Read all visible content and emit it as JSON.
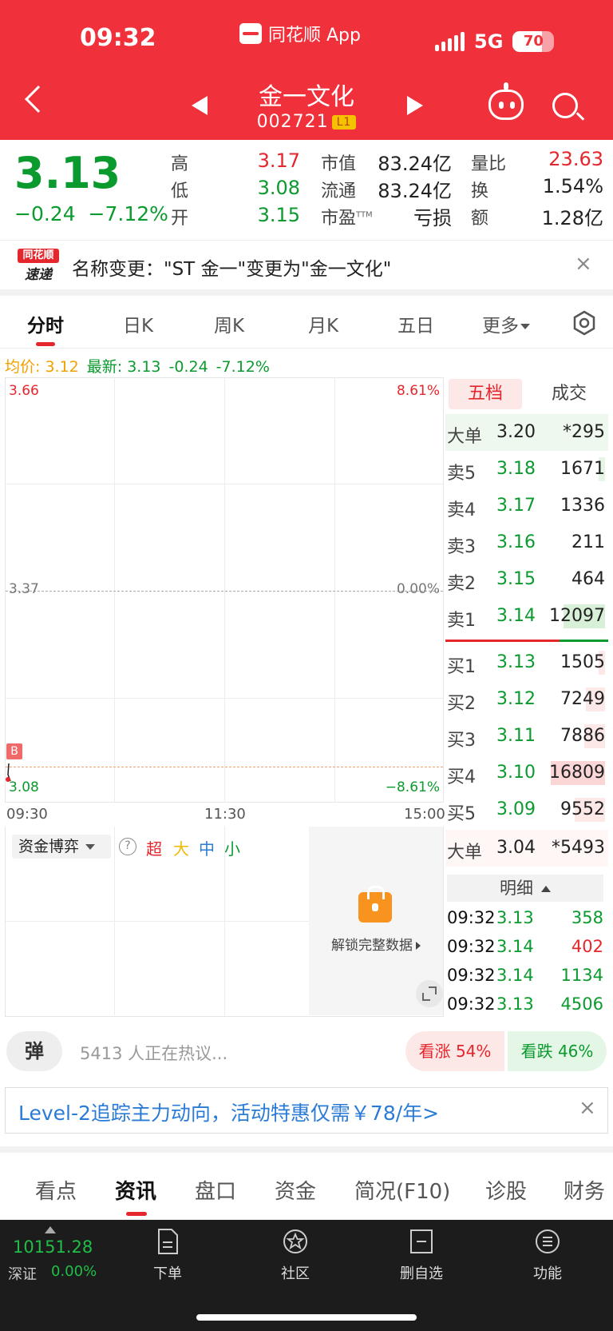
{
  "status": {
    "time": "09:32",
    "app_name": "同花顺 App",
    "network": "5G",
    "battery": "70",
    "battery_level": 0.7
  },
  "header": {
    "stock_name": "金一文化",
    "stock_code": "002721",
    "level_badge": "L1"
  },
  "quote": {
    "price": "3.13",
    "change": "−0.24",
    "change_pct": "−7.12%",
    "high_label": "高",
    "high": "3.17",
    "low_label": "低",
    "low": "3.08",
    "open_label": "开",
    "open": "3.15",
    "mkt_cap_label": "市值",
    "mkt_cap": "83.24亿",
    "float_label": "流通",
    "float_cap": "83.24亿",
    "pe_label": "市盈",
    "pe_sup": "TTM",
    "pe": "亏损",
    "vol_ratio_label": "量比",
    "vol_ratio": "23.63",
    "turnover_label": "换",
    "turnover": "1.54%",
    "amount_label": "额",
    "amount": "1.28亿"
  },
  "notice": {
    "logo_top": "同花顺",
    "logo_bottom": "速递",
    "text": "名称变更：\"ST 金一\"变更为\"金一文化\""
  },
  "chart_tabs": [
    {
      "label": "分时"
    },
    {
      "label": "日K"
    },
    {
      "label": "周K"
    },
    {
      "label": "月K"
    },
    {
      "label": "五日"
    },
    {
      "label": "更多"
    }
  ],
  "avg_line": {
    "avg": "均价: 3.12",
    "latest": "最新: 3.13",
    "chg": "-0.24",
    "pct": "-7.12%"
  },
  "chart": {
    "top_price": "3.66",
    "top_pct": "8.61%",
    "mid_price": "3.37",
    "mid_pct": "0.00%",
    "low_price": "3.08",
    "low_pct": "−8.61%",
    "time_start": "09:30",
    "time_mid": "11:30",
    "time_end": "15:00",
    "marker": "B"
  },
  "orderbook": {
    "tab_active": "五档",
    "tab_other": "成交",
    "big_sell": {
      "k": "大单",
      "p": "3.20",
      "v": "*295"
    },
    "sells": [
      {
        "k": "卖5",
        "p": "3.18",
        "v": "1671"
      },
      {
        "k": "卖4",
        "p": "3.17",
        "v": "1336"
      },
      {
        "k": "卖3",
        "p": "3.16",
        "v": "211"
      },
      {
        "k": "卖2",
        "p": "3.15",
        "v": "464"
      },
      {
        "k": "卖1",
        "p": "3.14",
        "v": "12097"
      }
    ],
    "buys": [
      {
        "k": "买1",
        "p": "3.13",
        "v": "1505"
      },
      {
        "k": "买2",
        "p": "3.12",
        "v": "7249"
      },
      {
        "k": "买3",
        "p": "3.11",
        "v": "7886"
      },
      {
        "k": "买4",
        "p": "3.10",
        "v": "16809"
      },
      {
        "k": "买5",
        "p": "3.09",
        "v": "9552"
      }
    ],
    "big_buy": {
      "k": "大单",
      "p": "3.04",
      "v": "*5493"
    }
  },
  "details": {
    "header": "明细",
    "rows": [
      {
        "t": "09:32",
        "p": "3.13",
        "v": "358"
      },
      {
        "t": "09:32",
        "p": "3.14",
        "v": "402"
      },
      {
        "t": "09:32",
        "p": "3.14",
        "v": "1134"
      },
      {
        "t": "09:32",
        "p": "3.13",
        "v": "4506"
      }
    ]
  },
  "flow": {
    "selector": "资金博弈",
    "help": "?",
    "legend": [
      "超",
      "大",
      "中",
      "小"
    ],
    "unlock": "解锁完整数据"
  },
  "discuss": {
    "danmu": "弹",
    "text": "5413 人正在热议...",
    "up": "看涨 54%",
    "down": "看跌 46%"
  },
  "promo": {
    "text": "Level-2追踪主力动向，活动特惠仅需￥78/年>"
  },
  "info_tabs": [
    {
      "label": "看点"
    },
    {
      "label": "资讯"
    },
    {
      "label": "盘口"
    },
    {
      "label": "资金"
    },
    {
      "label": "简况(F10)"
    },
    {
      "label": "诊股"
    },
    {
      "label": "财务"
    }
  ],
  "bottom": {
    "index_value": "10151.28",
    "index_name": "深证",
    "index_chg": "0.00%",
    "items": [
      {
        "label": "下单"
      },
      {
        "label": "社区"
      },
      {
        "label": "删自选"
      },
      {
        "label": "功能"
      }
    ]
  },
  "colors": {
    "brand_red": "#f0303a",
    "up_red": "#e5262c",
    "down_green": "#0b9a2e"
  }
}
